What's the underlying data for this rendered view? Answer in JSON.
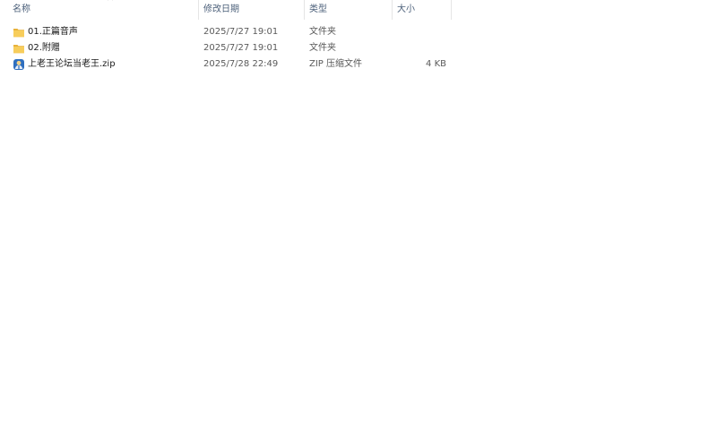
{
  "columns": {
    "name": "名称",
    "date": "修改日期",
    "type": "类型",
    "size": "大小"
  },
  "files": [
    {
      "icon": "folder-icon",
      "name": "01.正篇音声",
      "date": "2025/7/27 19:01",
      "type": "文件夹",
      "size": ""
    },
    {
      "icon": "folder-icon",
      "name": "02.附赠",
      "date": "2025/7/27 19:01",
      "type": "文件夹",
      "size": ""
    },
    {
      "icon": "zip-archive-icon",
      "name": "上老王论坛当老王.zip",
      "date": "2025/7/28 22:49",
      "type": "ZIP 压缩文件",
      "size": "4 KB"
    }
  ],
  "colors": {
    "header_text": "#4c607a",
    "folder": "#f4c24d",
    "zip_blue": "#2f6fbf"
  }
}
